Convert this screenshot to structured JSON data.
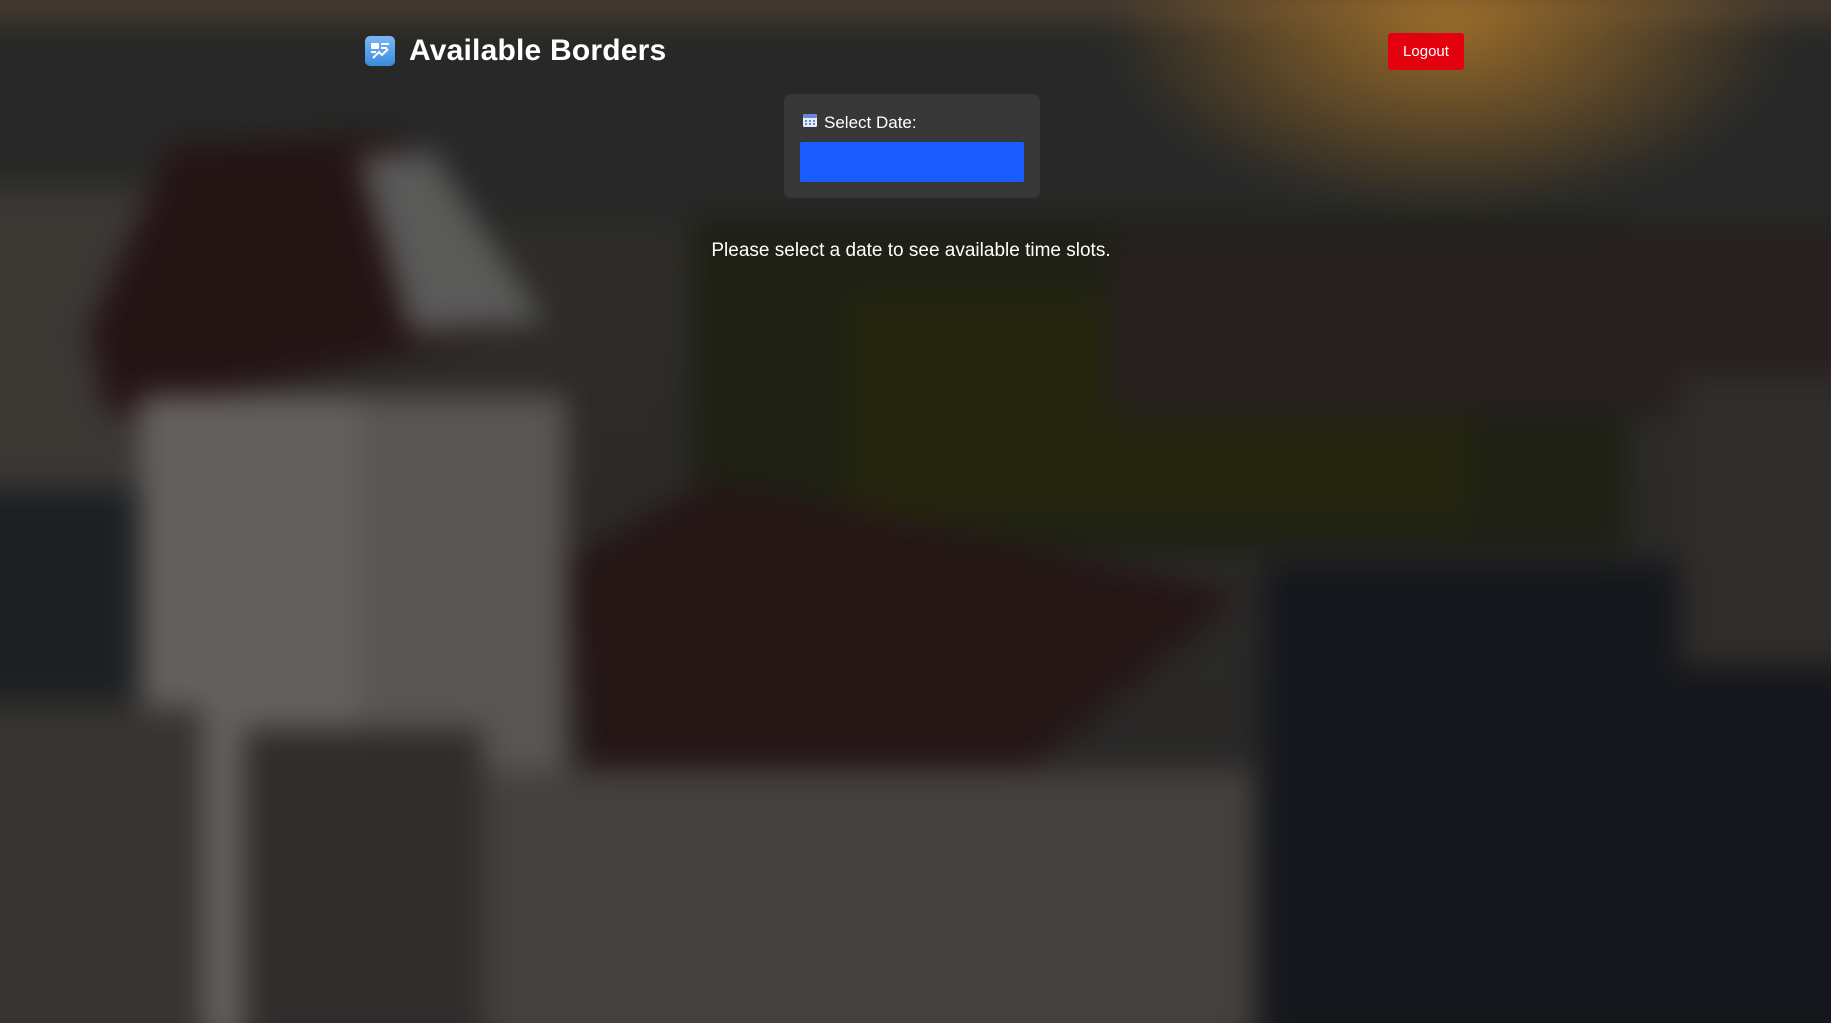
{
  "header": {
    "title": "Available Borders",
    "logout_label": "Logout"
  },
  "date_picker": {
    "label": "Select Date:",
    "value": ""
  },
  "message": "Please select a date to see available time slots.",
  "icons": {
    "app": "border-crossing-icon",
    "calendar": "calendar-icon"
  },
  "colors": {
    "logout_button": "#e3000f",
    "date_input": "#1a5cff",
    "panel": "#3c3c3e",
    "text": "#ffffff"
  }
}
